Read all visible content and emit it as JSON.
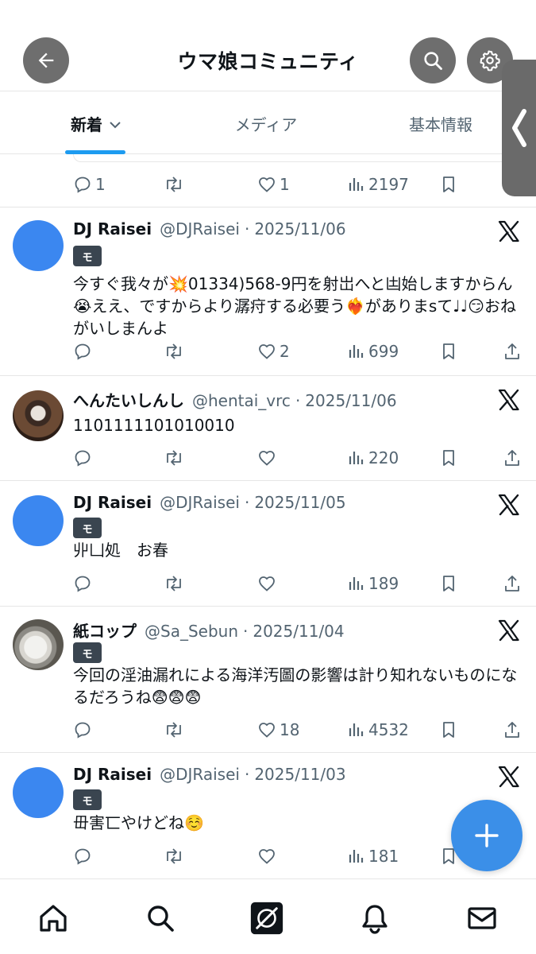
{
  "header": {
    "title": "ウマ娘コミュニティ",
    "back_icon": "arrow-left-icon",
    "search_icon": "search-icon",
    "settings_icon": "gear-icon"
  },
  "tabs": [
    {
      "label": "新着",
      "active": true,
      "icon": "chevron-down-icon"
    },
    {
      "label": "メディア",
      "active": false
    },
    {
      "label": "基本情報",
      "active": false
    }
  ],
  "partial_post": {
    "replies": "1",
    "likes": "1",
    "views": "2197"
  },
  "posts": [
    {
      "name": "DJ Raisei",
      "handle": "@DJRaisei",
      "sep": "·",
      "date": "2025/11/06",
      "badge": "モ",
      "text": "今すぐ我々が💥01334)568-9円を射岀へと凷始しますからん😭ええ、ですからより潺疛する必要う❤️‍🔥がありまsて♩♩😏おねがいしまんよ",
      "replies": "",
      "likes": "2",
      "views": "699"
    },
    {
      "name": "へんたいしんし",
      "handle": "@hentai_vrc",
      "sep": "·",
      "date": "2025/11/06",
      "text": "1101111101010010",
      "replies": "",
      "likes": "",
      "views": "220"
    },
    {
      "name": "DJ Raisei",
      "handle": "@DJRaisei",
      "sep": "·",
      "date": "2025/11/05",
      "badge": "モ",
      "text": "丱凵処　お春",
      "replies": "",
      "likes": "",
      "views": "189"
    },
    {
      "name": "紙コップ",
      "handle": "@Sa_Sebun",
      "sep": "·",
      "date": "2025/11/04",
      "badge": "モ",
      "text": "今回の淫油漏れによる海洋汚圖の影響は計り知れないものになるだろうね😨😨😨",
      "replies": "",
      "likes": "18",
      "views": "4532"
    },
    {
      "name": "DJ Raisei",
      "handle": "@DJRaisei",
      "sep": "·",
      "date": "2025/11/03",
      "badge": "モ",
      "text": "毌害匸やけどね☺️",
      "replies": "",
      "likes": "",
      "views": "181"
    }
  ],
  "colors": {
    "accent": "#1d9bf0",
    "avatar_blue": "#3b87f0",
    "secondary_text": "#536471",
    "header_button": "#6e6e6e"
  },
  "bottom_nav": [
    "home-icon",
    "search-icon",
    "grok-icon",
    "bell-icon",
    "mail-icon"
  ]
}
